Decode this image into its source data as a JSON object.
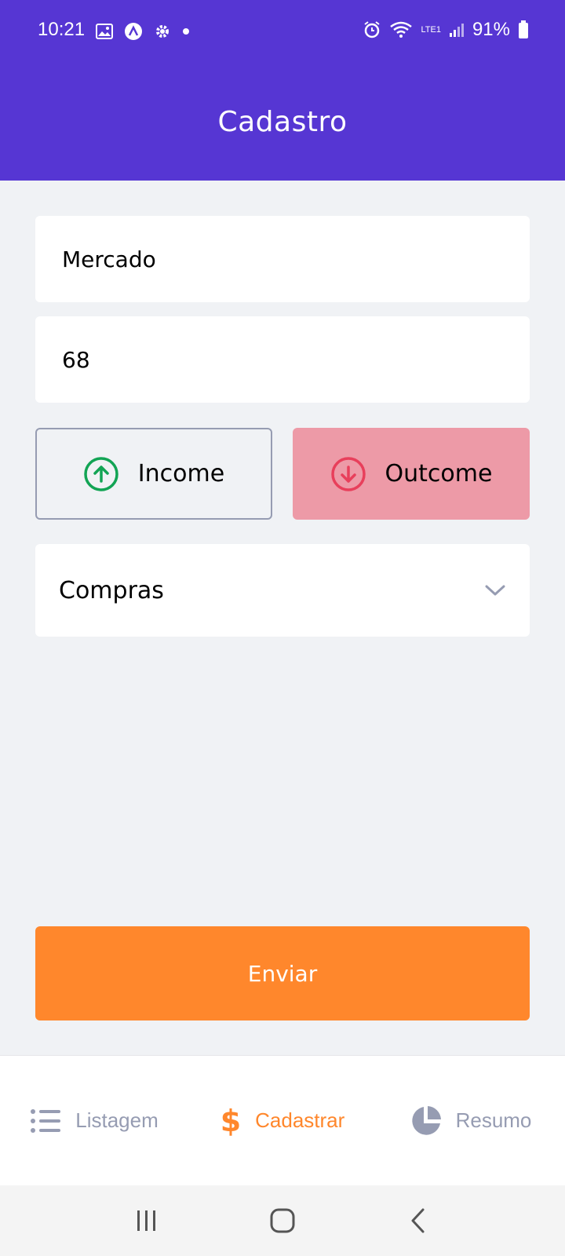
{
  "status_bar": {
    "time": "10:21",
    "battery": "91%",
    "signal_label": "LTE1"
  },
  "header": {
    "title": "Cadastro"
  },
  "form": {
    "name_value": "Mercado",
    "price_value": "68",
    "income_label": "Income",
    "outcome_label": "Outcome",
    "category_value": "Compras",
    "submit_label": "Enviar"
  },
  "tabs": [
    {
      "label": "Listagem",
      "icon": "list-icon",
      "active": false
    },
    {
      "label": "Cadastrar",
      "icon": "dollar-icon",
      "active": true
    },
    {
      "label": "Resumo",
      "icon": "pie-chart-icon",
      "active": false
    }
  ],
  "colors": {
    "primary": "#5636d3",
    "accent": "#ff872c",
    "income": "#12a454",
    "outcome": "#e83f5b",
    "outcome_selected_bg": "#ed9aa7",
    "muted": "#969cb2",
    "background": "#f0f2f5"
  }
}
